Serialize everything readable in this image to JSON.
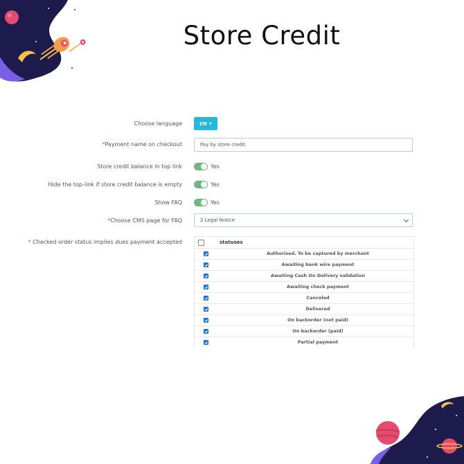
{
  "page": {
    "title": "Store Credit"
  },
  "form": {
    "choose_language_label": "Choose language",
    "language_button": "EN",
    "payment_name_label": "Payment name on checkout",
    "payment_name_value": "Pay by store credit",
    "balance_top_link_label": "Store credit balance in top link",
    "balance_top_link_value": "Yes",
    "hide_top_link_label": "Hide the top-link if store credit balance is empty",
    "hide_top_link_value": "Yes",
    "show_faq_label": "Show FAQ",
    "show_faq_value": "Yes",
    "cms_page_label": "Choose CMS page for FAQ",
    "cms_page_value": "2 Legal Notice",
    "order_status_label": "Checked order status implies dues payment accepted",
    "required_mark": "*"
  },
  "statuses_table": {
    "header": "statuses",
    "rows": [
      {
        "name": "Authorized. To be captured by merchant",
        "checked": true
      },
      {
        "name": "Awaiting bank wire payment",
        "checked": true
      },
      {
        "name": "Awaiting Cash On Delivery validation",
        "checked": true
      },
      {
        "name": "Awaiting check payment",
        "checked": true
      },
      {
        "name": "Canceled",
        "checked": true
      },
      {
        "name": "Delivered",
        "checked": true
      },
      {
        "name": "On backorder (not paid)",
        "checked": true
      },
      {
        "name": "On backorder (paid)",
        "checked": true
      },
      {
        "name": "Partial payment",
        "checked": true
      }
    ]
  },
  "colors": {
    "accent_button": "#25b9d7",
    "switch_on": "#70b580",
    "checkbox": "#1a73e8",
    "required": "#e0455a"
  },
  "icons": {
    "caret": "caret-down-icon",
    "select": "chevron-down-icon",
    "check": "check-icon"
  }
}
